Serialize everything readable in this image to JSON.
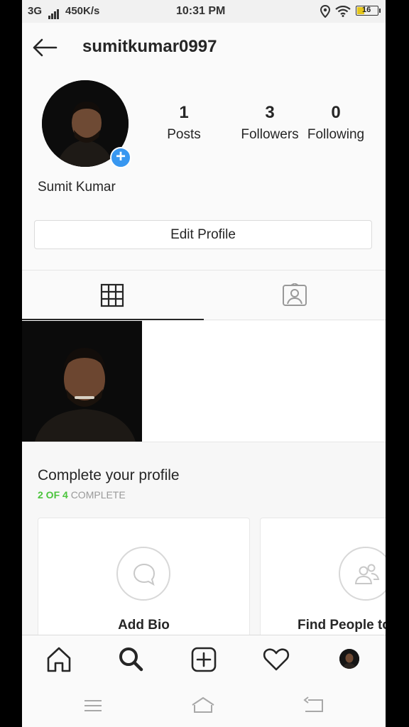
{
  "status_bar": {
    "network": "3G",
    "speed": "450K/s",
    "time": "10:31 PM",
    "battery": "16"
  },
  "header": {
    "username": "sumitkumar0997"
  },
  "profile": {
    "full_name": "Sumit Kumar",
    "stats": [
      {
        "value": "1",
        "label": "Posts"
      },
      {
        "value": "3",
        "label": "Followers"
      },
      {
        "value": "0",
        "label": "Following"
      }
    ],
    "edit_button": "Edit Profile"
  },
  "tabs": [
    {
      "icon": "grid-icon",
      "active": true
    },
    {
      "icon": "tagged-person-icon",
      "active": false
    }
  ],
  "posts_count_shown": 1,
  "complete_profile": {
    "title": "Complete your profile",
    "progress_count": "2 OF 4",
    "progress_word": "COMPLETE",
    "cards": [
      {
        "icon": "chat-bubble-icon",
        "title": "Add Bio"
      },
      {
        "icon": "people-icon",
        "title": "Find People to"
      }
    ]
  },
  "bottom_nav": [
    "home-icon",
    "search-icon",
    "add-post-icon",
    "heart-icon",
    "profile-avatar"
  ],
  "colors": {
    "accent_blue": "#3897f0",
    "progress_green": "#4bc43c",
    "text": "#262626"
  }
}
